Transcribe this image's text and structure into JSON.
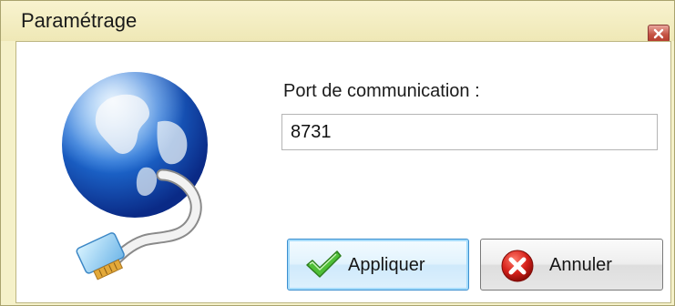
{
  "window": {
    "title": "Paramétrage",
    "close_symbol": "x"
  },
  "form": {
    "port_label": "Port de communication :",
    "port_value": "8731"
  },
  "buttons": {
    "apply_label": "Appliquer",
    "cancel_label": "Annuler"
  },
  "icons": {
    "illustration": "globe-network-cable-icon",
    "apply": "green-checkmark-icon",
    "cancel": "red-cross-circle-icon",
    "close": "close-icon"
  },
  "colors": {
    "titlebar": "#f5f1c9",
    "close_button": "#c55445",
    "focus_border": "#3b8fcf"
  }
}
